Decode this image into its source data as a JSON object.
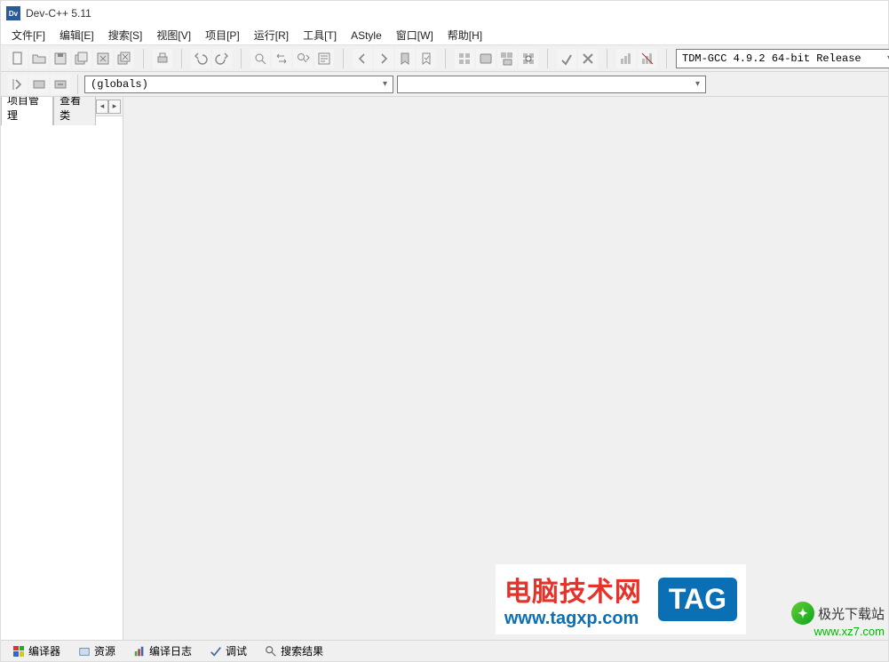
{
  "title": "Dev-C++ 5.11",
  "menu": {
    "file": "文件[F]",
    "edit": "编辑[E]",
    "search": "搜索[S]",
    "view": "视图[V]",
    "project": "项目[P]",
    "run": "运行[R]",
    "tools": "工具[T]",
    "astyle": "AStyle",
    "window": "窗口[W]",
    "help": "帮助[H]"
  },
  "toolbar": {
    "compiler_profile": "TDM-GCC 4.9.2 64-bit Release"
  },
  "classbar": {
    "scope": "(globals)",
    "member": ""
  },
  "sidebar": {
    "tab1": "项目管理",
    "tab2": "查看类"
  },
  "bottom": {
    "compiler": "编译器",
    "resources": "资源",
    "compile_log": "编译日志",
    "debug": "调试",
    "search_results": "搜索结果"
  },
  "watermark": {
    "line1": "电脑技术网",
    "line2": "www.tagxp.com",
    "tag": "TAG",
    "site2_name": "极光下载站",
    "site2_url": "www.xz7.com"
  }
}
